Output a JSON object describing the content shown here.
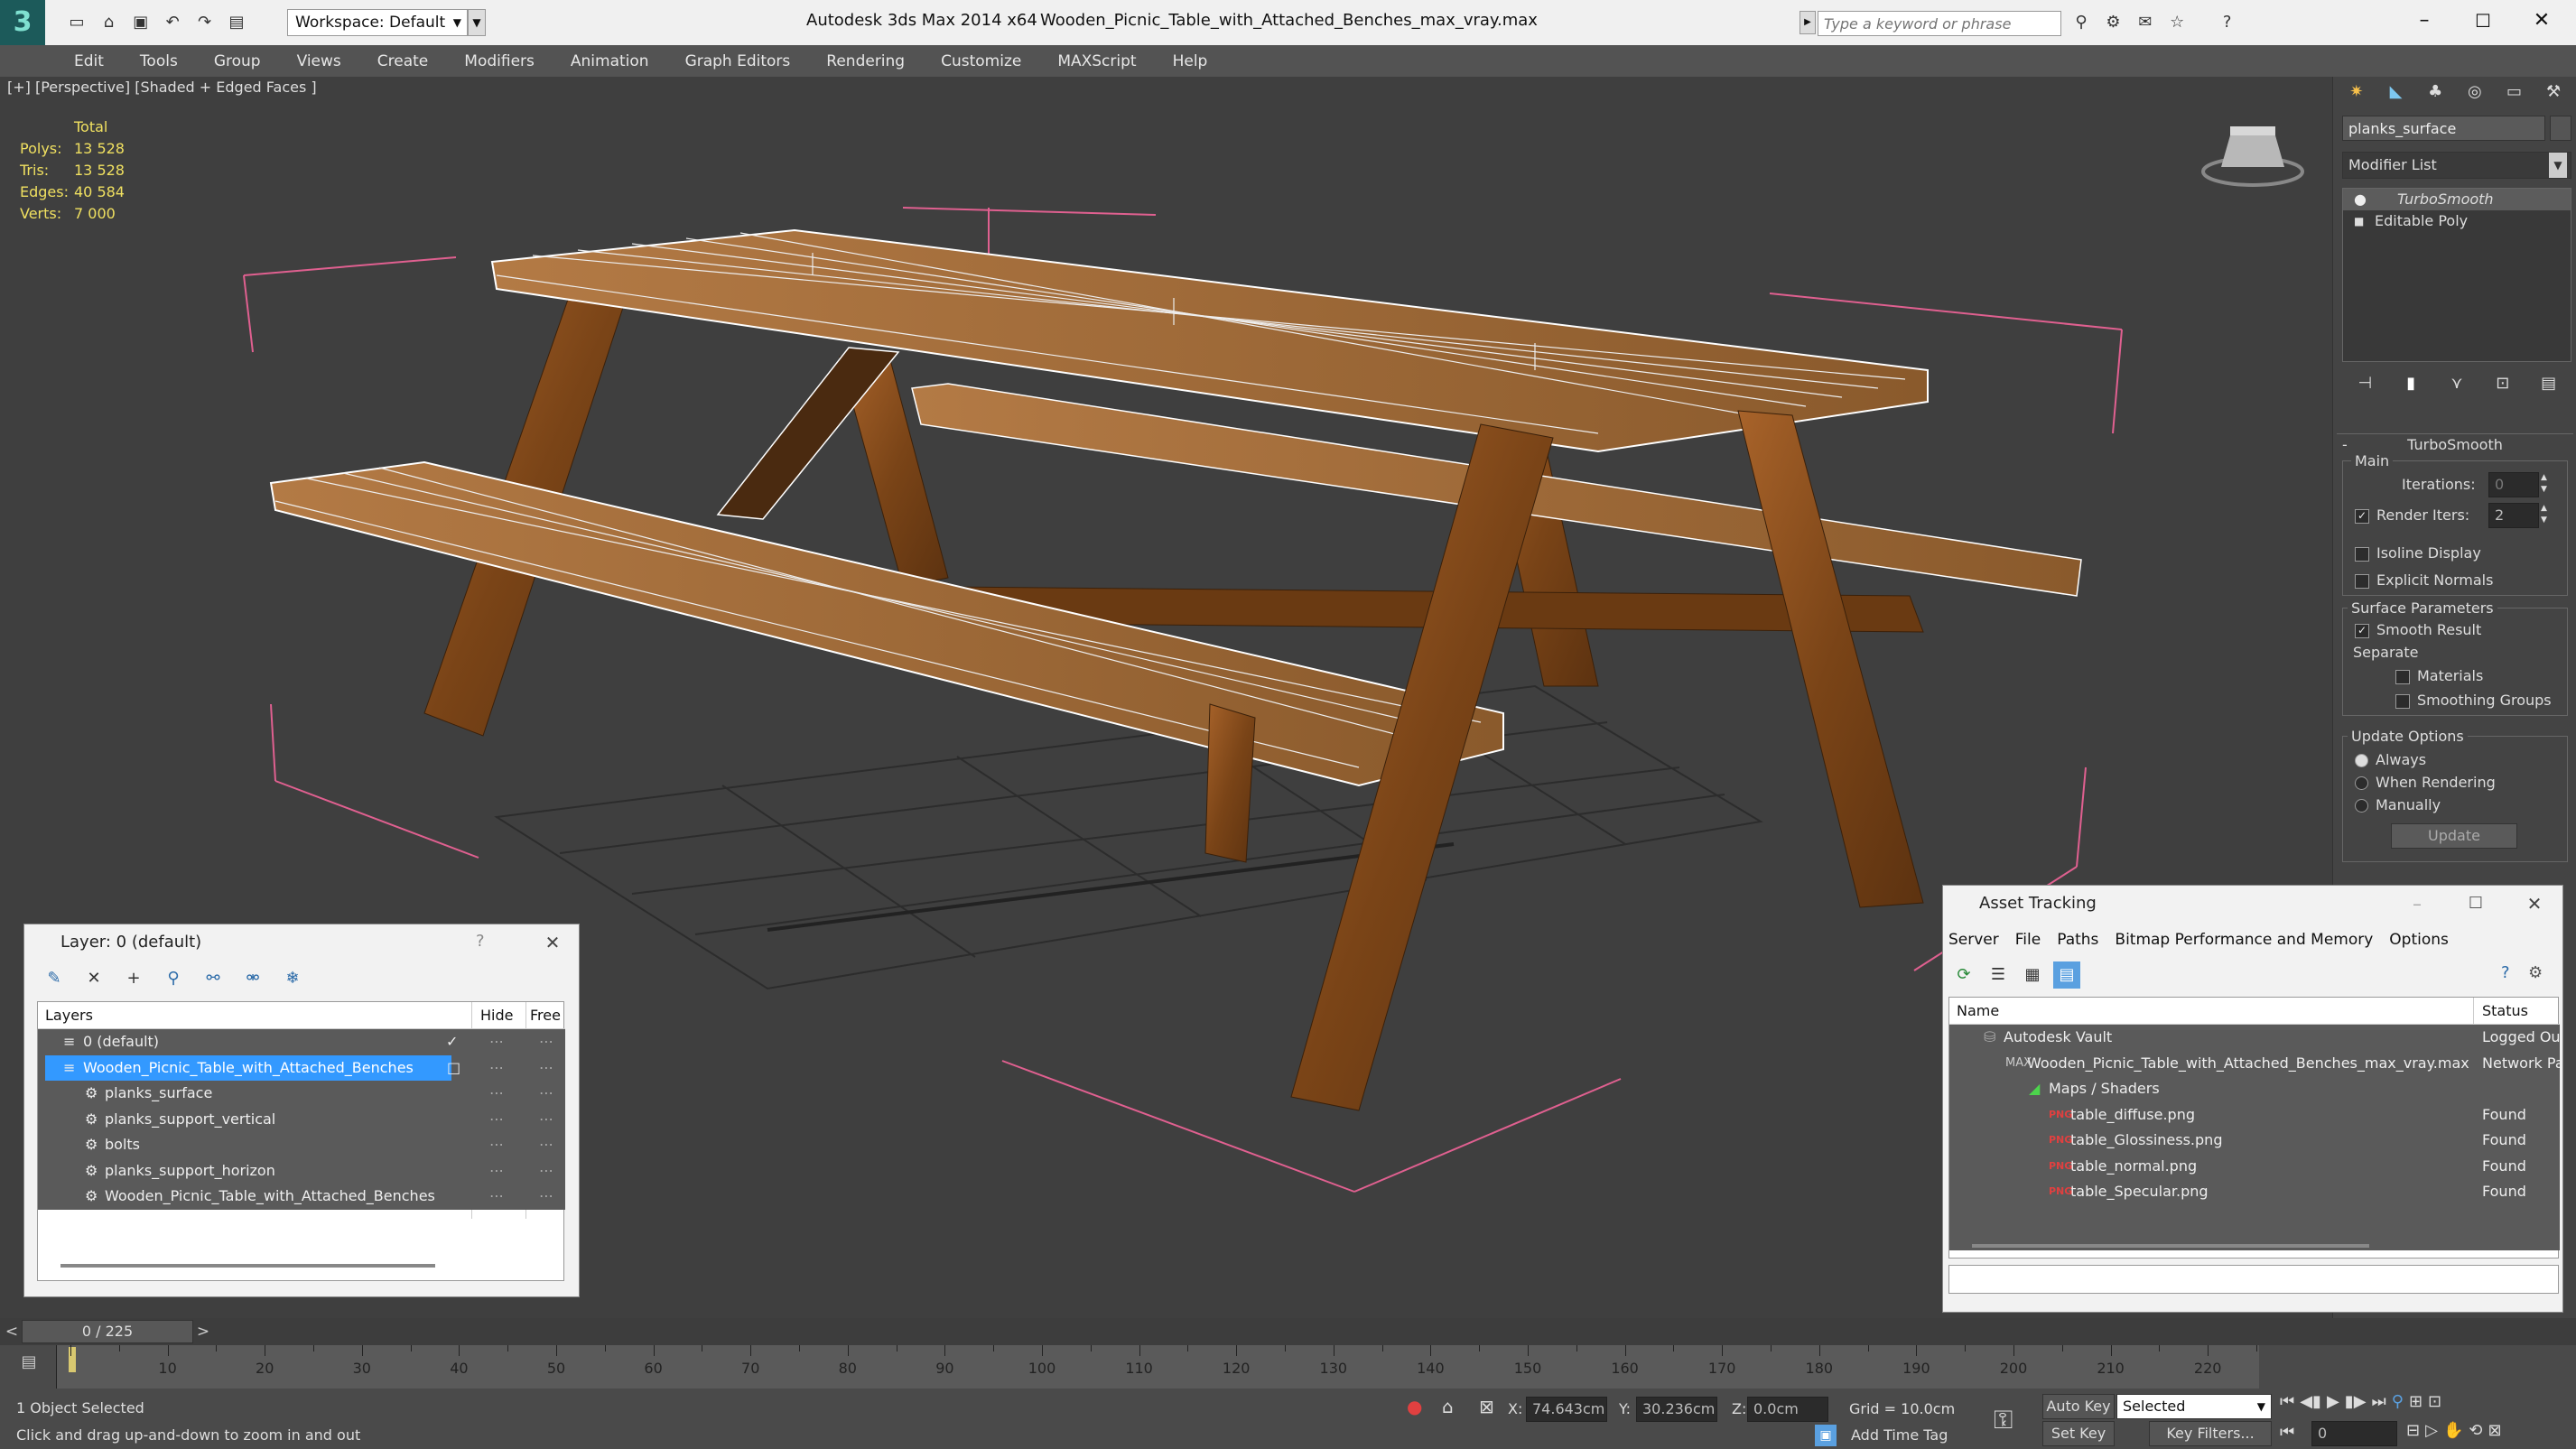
{
  "titlebar": {
    "workspace_label": "Workspace: Default",
    "app_title": "Autodesk 3ds Max  2014 x64",
    "file_title": "Wooden_Picnic_Table_with_Attached_Benches_max_vray.max",
    "search_placeholder": "Type a keyword or phrase"
  },
  "menu": [
    "Edit",
    "Tools",
    "Group",
    "Views",
    "Create",
    "Modifiers",
    "Animation",
    "Graph Editors",
    "Rendering",
    "Customize",
    "MAXScript",
    "Help"
  ],
  "viewport": {
    "label": "[+] [Perspective] [Shaded + Edged Faces ]",
    "stats_header": "Total",
    "stats": [
      {
        "label": "Polys:",
        "value": "13 528"
      },
      {
        "label": "Tris:",
        "value": "13 528"
      },
      {
        "label": "Edges:",
        "value": "40 584"
      },
      {
        "label": "Verts:",
        "value": "7 000"
      }
    ]
  },
  "command_panel": {
    "object_name": "planks_surface",
    "modifier_list": "Modifier List",
    "stack": [
      "TurboSmooth",
      "Editable Poly"
    ],
    "rollout_title": "TurboSmooth",
    "main_group": "Main",
    "iterations_label": "Iterations:",
    "iterations_value": "0",
    "render_iters_label": "Render Iters:",
    "render_iters_value": "2",
    "isoline_label": "Isoline Display",
    "explicit_normals_label": "Explicit Normals",
    "surface_params_label": "Surface Parameters",
    "smooth_result_label": "Smooth Result",
    "separate_label": "Separate",
    "materials_label": "Materials",
    "smoothing_groups_label": "Smoothing Groups",
    "update_options_label": "Update Options",
    "always_label": "Always",
    "when_rendering_label": "When Rendering",
    "manually_label": "Manually",
    "update_button": "Update"
  },
  "layer_dialog": {
    "title": "Layer: 0 (default)",
    "help": "?",
    "col_layers": "Layers",
    "col_hide": "Hide",
    "col_freeze": "Free",
    "rows": [
      {
        "name": "0 (default)",
        "indent": 0,
        "type": "layer",
        "selected": false
      },
      {
        "name": "Wooden_Picnic_Table_with_Attached_Benches",
        "indent": 0,
        "type": "layer",
        "selected": true
      },
      {
        "name": "planks_surface",
        "indent": 1,
        "type": "object",
        "selected": false
      },
      {
        "name": "planks_support_vertical",
        "indent": 1,
        "type": "object",
        "selected": false
      },
      {
        "name": "bolts",
        "indent": 1,
        "type": "object",
        "selected": false
      },
      {
        "name": "planks_support_horizon",
        "indent": 1,
        "type": "object",
        "selected": false
      },
      {
        "name": "Wooden_Picnic_Table_with_Attached_Benches",
        "indent": 1,
        "type": "object",
        "selected": false
      }
    ]
  },
  "asset_dialog": {
    "title": "Asset Tracking",
    "menu": [
      "Server",
      "File",
      "Paths",
      "Bitmap Performance and Memory",
      "Options"
    ],
    "col_name": "Name",
    "col_status": "Status",
    "rows": [
      {
        "name": "Autodesk Vault",
        "indent": 0,
        "icon": "vault",
        "status": "Logged Out"
      },
      {
        "name": "Wooden_Picnic_Table_with_Attached_Benches_max_vray.max",
        "indent": 1,
        "icon": "max",
        "status": "Network Path"
      },
      {
        "name": "Maps / Shaders",
        "indent": 2,
        "icon": "folder",
        "status": ""
      },
      {
        "name": "table_diffuse.png",
        "indent": 3,
        "icon": "png",
        "status": "Found"
      },
      {
        "name": "table_Glossiness.png",
        "indent": 3,
        "icon": "png",
        "status": "Found"
      },
      {
        "name": "table_normal.png",
        "indent": 3,
        "icon": "png",
        "status": "Found"
      },
      {
        "name": "table_Specular.png",
        "indent": 3,
        "icon": "png",
        "status": "Found"
      }
    ]
  },
  "timeline": {
    "frame_label": "0 / 225",
    "ticks": [
      "10",
      "20",
      "30",
      "40",
      "50",
      "60",
      "70",
      "80",
      "90",
      "100",
      "110",
      "120",
      "130",
      "140",
      "150",
      "160",
      "170",
      "180",
      "190",
      "200",
      "210",
      "220"
    ]
  },
  "status": {
    "selection": "1 Object Selected",
    "prompt": "Click and drag up-and-down to zoom in and out",
    "x_label": "X:",
    "x_value": "74.643cm",
    "y_label": "Y:",
    "y_value": "30.236cm",
    "z_label": "Z:",
    "z_value": "0.0cm",
    "grid": "Grid = 10.0cm",
    "add_time_tag": "Add Time Tag",
    "auto_key": "Auto Key",
    "set_key": "Set Key",
    "key_mode": "Selected",
    "key_filters": "Key Filters...",
    "frame_value": "0"
  },
  "colors": {
    "selection_blue": "#3399ff",
    "wood": "#8a4f1c",
    "bbox_pink": "#e06090",
    "stats_yellow": "#f0e060"
  }
}
